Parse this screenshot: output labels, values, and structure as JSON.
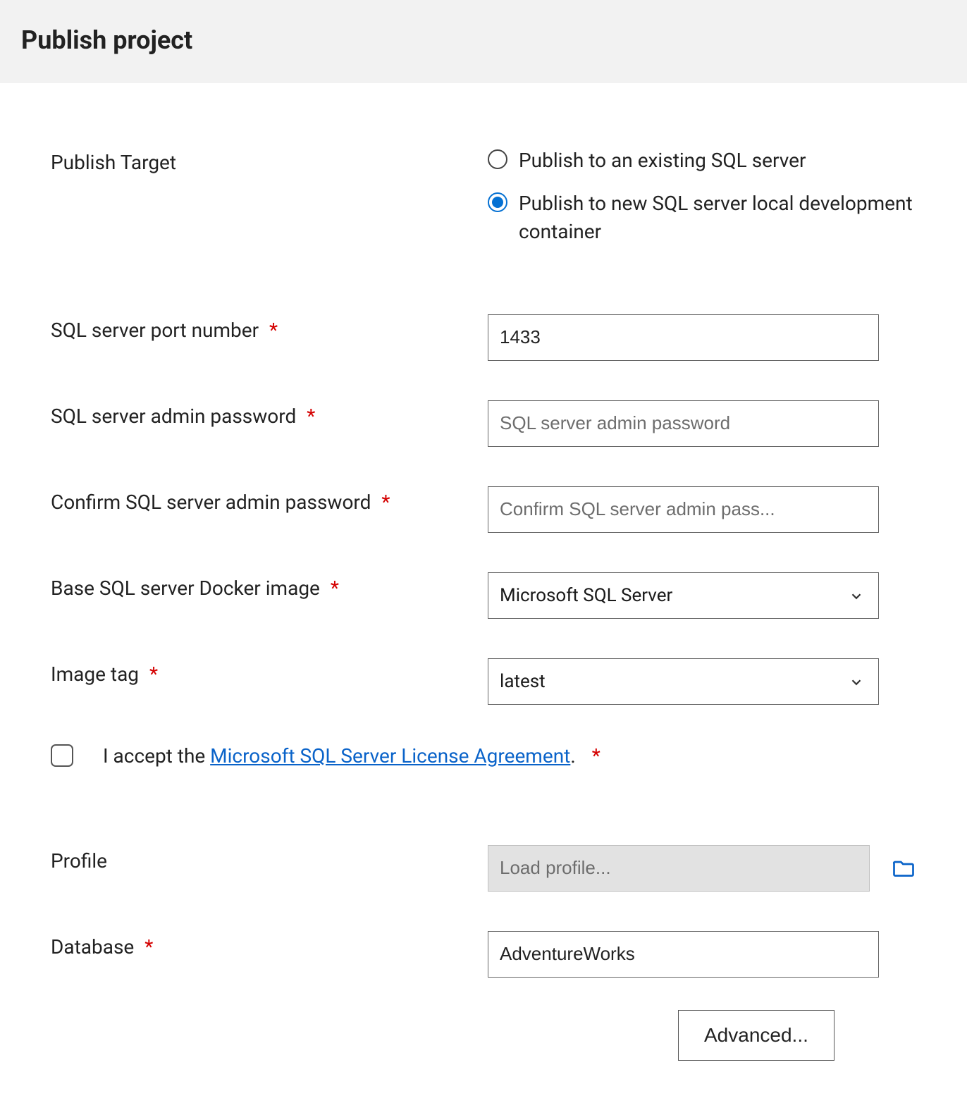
{
  "header": {
    "title": "Publish project"
  },
  "publishTarget": {
    "label": "Publish Target",
    "options": [
      {
        "label": "Publish to an existing SQL server",
        "selected": false
      },
      {
        "label": "Publish to new SQL server local development container",
        "selected": true
      }
    ]
  },
  "port": {
    "label": "SQL server port number",
    "value": "1433"
  },
  "adminPassword": {
    "label": "SQL server admin password",
    "placeholder": "SQL server admin password"
  },
  "confirmPassword": {
    "label": "Confirm SQL server admin password",
    "placeholder": "Confirm SQL server admin pass..."
  },
  "dockerImage": {
    "label": "Base SQL server Docker image",
    "value": "Microsoft SQL Server"
  },
  "imageTag": {
    "label": "Image tag",
    "value": "latest"
  },
  "license": {
    "prefix": "I accept the ",
    "linkText": "Microsoft SQL Server License Agreement",
    "suffix": "."
  },
  "profile": {
    "label": "Profile",
    "placeholder": "Load profile..."
  },
  "database": {
    "label": "Database",
    "value": "AdventureWorks"
  },
  "advancedButton": "Advanced...",
  "requiredMark": "*"
}
